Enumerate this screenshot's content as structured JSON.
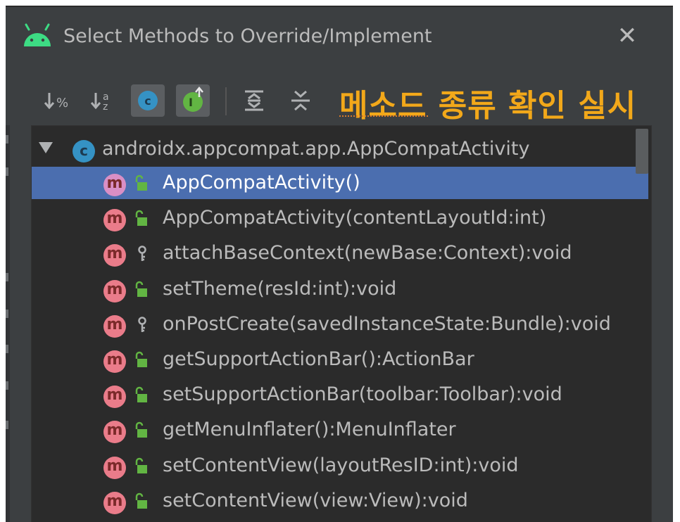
{
  "dialog": {
    "title": "Select Methods to Override/Implement",
    "close_glyph": "✕"
  },
  "toolbar": {
    "buttons": [
      {
        "icon": "sort-by-percent-icon",
        "state": "off"
      },
      {
        "icon": "sort-alphabetically-icon",
        "state": "off"
      },
      {
        "icon": "show-classes-icon",
        "state": "on"
      },
      {
        "icon": "show-interfaces-icon",
        "state": "on"
      },
      {
        "icon": "expand-all-icon",
        "state": "off"
      },
      {
        "icon": "collapse-all-icon",
        "state": "off"
      }
    ],
    "annotation": "메소드 종류 확인 실시"
  },
  "tree": {
    "class_node": {
      "icon_letter": "c",
      "label": "androidx.appcompat.app.AppCompatActivity",
      "expanded": true
    },
    "methods": [
      {
        "icon_letter": "m",
        "visibility": "public",
        "label": "AppCompatActivity()",
        "selected": true
      },
      {
        "icon_letter": "m",
        "visibility": "public",
        "label": "AppCompatActivity(contentLayoutId:int)",
        "selected": false
      },
      {
        "icon_letter": "m",
        "visibility": "protected",
        "label": "attachBaseContext(newBase:Context):void",
        "selected": false
      },
      {
        "icon_letter": "m",
        "visibility": "public",
        "label": "setTheme(resId:int):void",
        "selected": false
      },
      {
        "icon_letter": "m",
        "visibility": "protected",
        "label": "onPostCreate(savedInstanceState:Bundle):void",
        "selected": false
      },
      {
        "icon_letter": "m",
        "visibility": "public",
        "label": "getSupportActionBar():ActionBar",
        "selected": false
      },
      {
        "icon_letter": "m",
        "visibility": "public",
        "label": "setSupportActionBar(toolbar:Toolbar):void",
        "selected": false
      },
      {
        "icon_letter": "m",
        "visibility": "public",
        "label": "getMenuInflater():MenuInflater",
        "selected": false
      },
      {
        "icon_letter": "m",
        "visibility": "public",
        "label": "setContentView(layoutResID:int):void",
        "selected": false
      },
      {
        "icon_letter": "m",
        "visibility": "public",
        "label": "setContentView(view:View):void",
        "selected": false
      }
    ]
  },
  "colors": {
    "dialog_bg": "#3c3f41",
    "tree_bg": "#2b2b2b",
    "selection": "#4b6eaf",
    "annotation": "#f2a81a",
    "android_green": "#3ddc84",
    "method_icon": "#ea7c8a",
    "class_icon": "#3592c4"
  }
}
